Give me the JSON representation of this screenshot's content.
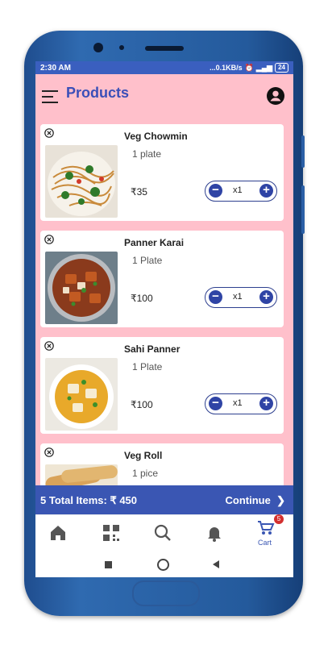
{
  "status_bar": {
    "time": "2:30 AM",
    "speed": "...0.1KB/s",
    "battery": "24"
  },
  "header": {
    "title": "Products"
  },
  "products": [
    {
      "name": "Veg Chowmin",
      "unit": "1 plate",
      "price": "₹35",
      "count": "x1"
    },
    {
      "name": "Panner Karai",
      "unit": "1 Plate",
      "price": "₹100",
      "count": "x1"
    },
    {
      "name": "Sahi Panner",
      "unit": "1 Plate",
      "price": "₹100",
      "count": "x1"
    },
    {
      "name": "Veg Roll",
      "unit": "1 pice",
      "price": "",
      "count": ""
    }
  ],
  "summary": {
    "total_label": "5  Total Items:  ₹ 450",
    "continue_label": "Continue"
  },
  "nav": {
    "cart_label": "Cart",
    "cart_badge": "5"
  },
  "colors": {
    "accent": "#3a56b3",
    "header_bg": "#ffc0cb",
    "badge": "#d32f2f"
  }
}
